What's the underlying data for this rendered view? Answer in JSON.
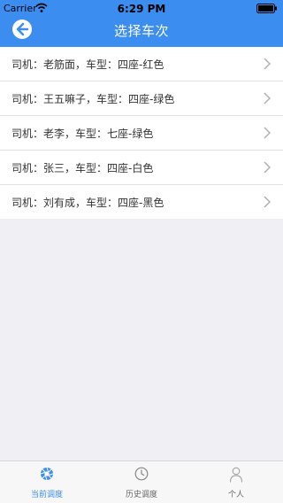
{
  "status_bar": {
    "carrier": "Carrier",
    "time": "6:29 PM"
  },
  "nav": {
    "title": "选择车次"
  },
  "drivers": [
    {
      "label": "司机：老筋面，车型：四座-红色"
    },
    {
      "label": "司机：王五嘛子，车型：四座-绿色"
    },
    {
      "label": "司机：老李，车型：七座-绿色"
    },
    {
      "label": "司机：张三，车型：四座-白色"
    },
    {
      "label": "司机：刘有成，车型：四座-黑色"
    }
  ],
  "tabs": [
    {
      "label": "当前调度",
      "icon": "aperture-icon",
      "active": true
    },
    {
      "label": "历史调度",
      "icon": "clock-icon",
      "active": false
    },
    {
      "label": "个人",
      "icon": "person-icon",
      "active": false
    }
  ],
  "colors": {
    "accent": "#3b8df0",
    "background": "#efeff4",
    "row_text": "#333333"
  }
}
